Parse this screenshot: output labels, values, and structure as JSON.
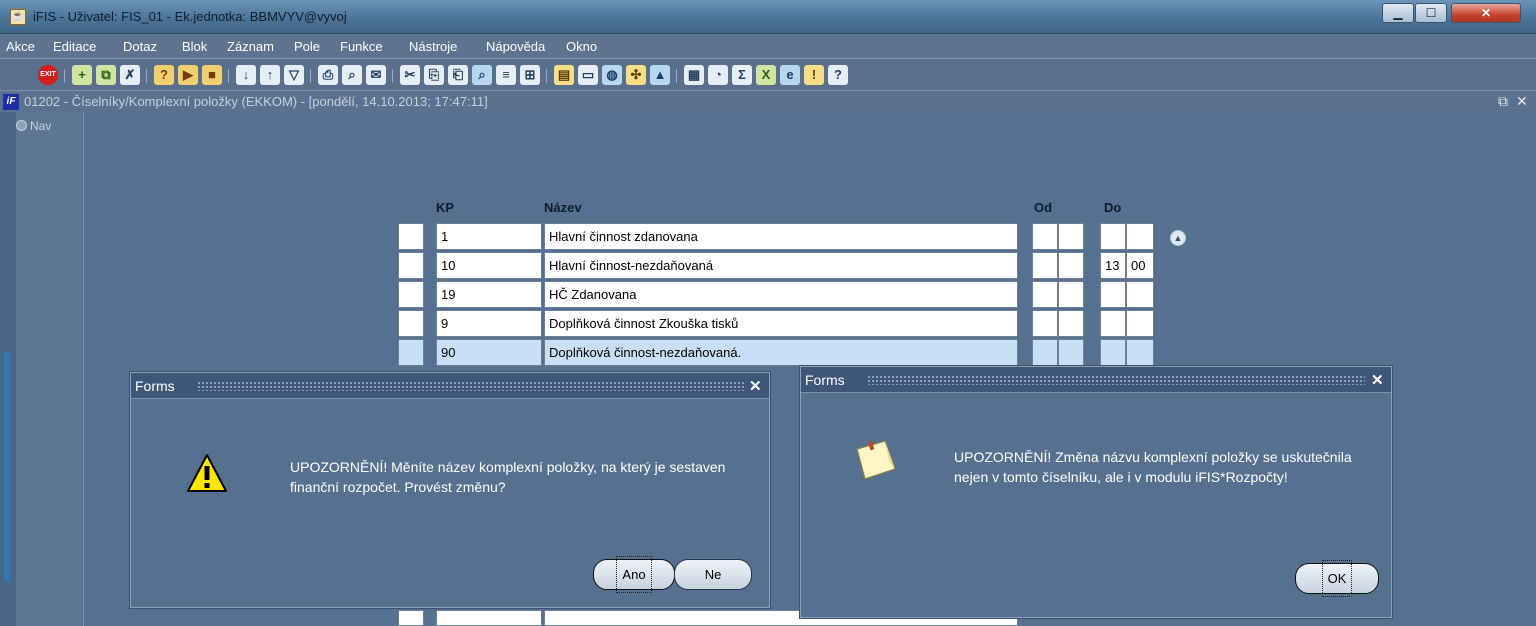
{
  "window": {
    "title": "iFIS - Uživatel: FIS_01 - Ek.jednotka: BBMVYV@vyvoj",
    "controls": [
      "minimize",
      "maximize",
      "close"
    ]
  },
  "menu": [
    "Akce",
    "Editace",
    "Dotaz",
    "Blok",
    "Záznam",
    "Pole",
    "Funkce",
    "Nástroje",
    "Nápověda",
    "Okno"
  ],
  "toolbar": {
    "exit_label": "EXIT",
    "sigma": "Σ",
    "question": "?"
  },
  "form": {
    "title": "01202 - Číselníky/Komplexní položky (EKKOM) - [pondělí, 14.10.2013; 17:47:11]",
    "nav_label": "Nav",
    "columns": {
      "kp": "KP",
      "nazev": "Název",
      "od": "Od",
      "do": "Do"
    },
    "rows": [
      {
        "kp": "1",
        "nazev": "Hlavní činnost zdanovana",
        "od1": "",
        "od2": "",
        "do1": "",
        "do2": ""
      },
      {
        "kp": "10",
        "nazev": "Hlavní činnost-nezdaňovaná",
        "od1": "",
        "od2": "",
        "do1": "13",
        "do2": "00"
      },
      {
        "kp": "19",
        "nazev": "HČ Zdanovana",
        "od1": "",
        "od2": "",
        "do1": "",
        "do2": ""
      },
      {
        "kp": "9",
        "nazev": "Doplňková činnost Zkouška tisků",
        "od1": "",
        "od2": "",
        "do1": "",
        "do2": ""
      },
      {
        "kp": "90",
        "nazev": "Doplňková činnost-nezdaňovaná.",
        "od1": "",
        "od2": "",
        "do1": "",
        "do2": ""
      }
    ]
  },
  "dialog_left": {
    "title": "Forms",
    "close": "✕",
    "message": "UPOZORNĚNÍ! Měníte název komplexní položky, na který je sestaven finanční rozpočet. Provést změnu?",
    "yes_label": "Ano",
    "no_label": "Ne"
  },
  "dialog_right": {
    "title": "Forms",
    "close": "✕",
    "message": "UPOZORNĚNÍ! Změna názvu komplexní položky se uskutečnila nejen v tomto číselníku, ale i v modulu iFIS*Rozpočty!",
    "ok_label": "OK"
  },
  "colors": {
    "form_bg": "#56708f",
    "menu_bg": "#5d7390",
    "selected_row": "#c8dff7"
  }
}
